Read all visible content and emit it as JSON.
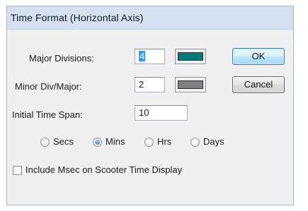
{
  "dialog": {
    "title": "Time Format (Horizontal Axis)"
  },
  "fields": {
    "major_divisions": {
      "label": "Major Divisions:",
      "value": "4",
      "color": "#007b7b"
    },
    "minor_div_major": {
      "label": "Minor Div/Major:",
      "value": "2",
      "color": "#808080"
    },
    "initial_time_span": {
      "label": "Initial Time Span:",
      "value": "10"
    }
  },
  "buttons": {
    "ok": "OK",
    "cancel": "Cancel"
  },
  "time_units": {
    "options": [
      {
        "label": "Secs",
        "selected": false
      },
      {
        "label": "Mins",
        "selected": true
      },
      {
        "label": "Hrs",
        "selected": false
      },
      {
        "label": "Days",
        "selected": false
      }
    ]
  },
  "include_msec": {
    "label": "Include Msec on Scooter Time Display",
    "checked": false
  }
}
